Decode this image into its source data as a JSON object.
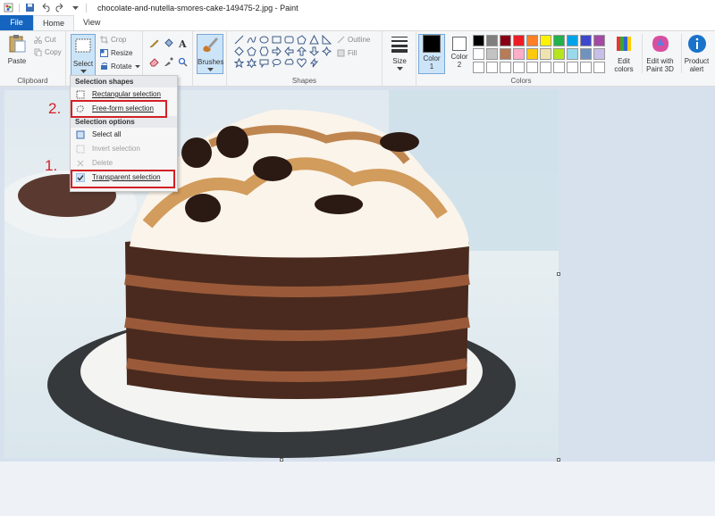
{
  "titlebar": {
    "title": "chocolate-and-nutella-smores-cake-149475-2.jpg - Paint",
    "icons": [
      "paint-app-icon",
      "save-icon",
      "undo-icon",
      "redo-icon",
      "customize-quick-access-icon"
    ]
  },
  "tabs": [
    {
      "label": "File"
    },
    {
      "label": "Home"
    },
    {
      "label": "View"
    }
  ],
  "ribbon": {
    "clipboard": {
      "paste": "Paste",
      "cut": "Cut",
      "copy": "Copy",
      "group": "Clipboard"
    },
    "image": {
      "select": "Select",
      "crop": "Crop",
      "resize": "Resize",
      "rotate": "Rotate"
    },
    "tools": {
      "brushes": "Brushes"
    },
    "shapes": {
      "outline": "Outline",
      "fill": "Fill",
      "group": "Shapes"
    },
    "size": "Size",
    "colors": {
      "color1": "Color\n1",
      "color2": "Color\n2",
      "edit_colors": "Edit\ncolors",
      "edit_paint3d": "Edit with\nPaint 3D",
      "product_alert": "Product\nalert",
      "group": "Colors",
      "color1_value": "#000000",
      "color2_value": "#ffffff",
      "palette": [
        "#000000",
        "#7f7f7f",
        "#880015",
        "#ed1c24",
        "#ff7f27",
        "#fff200",
        "#22b14c",
        "#00a2e8",
        "#3f48cc",
        "#a349a4",
        "#ffffff",
        "#c3c3c3",
        "#b97a57",
        "#ffaec9",
        "#ffc90e",
        "#efe4b0",
        "#b5e61d",
        "#99d9ea",
        "#7092be",
        "#c8bfe7",
        "#ffffff",
        "#ffffff",
        "#ffffff",
        "#ffffff",
        "#ffffff",
        "#ffffff",
        "#ffffff",
        "#ffffff",
        "#ffffff",
        "#ffffff"
      ]
    }
  },
  "menu": {
    "shapes_header": "Selection shapes",
    "rect": "Rectangular selection",
    "freeform": "Free-form selection",
    "options_header": "Selection options",
    "select_all": "Select all",
    "invert": "Invert selection",
    "delete": "Delete",
    "transparent": "Transparent selection"
  },
  "annotations": {
    "step1": "1.",
    "step2": "2."
  }
}
